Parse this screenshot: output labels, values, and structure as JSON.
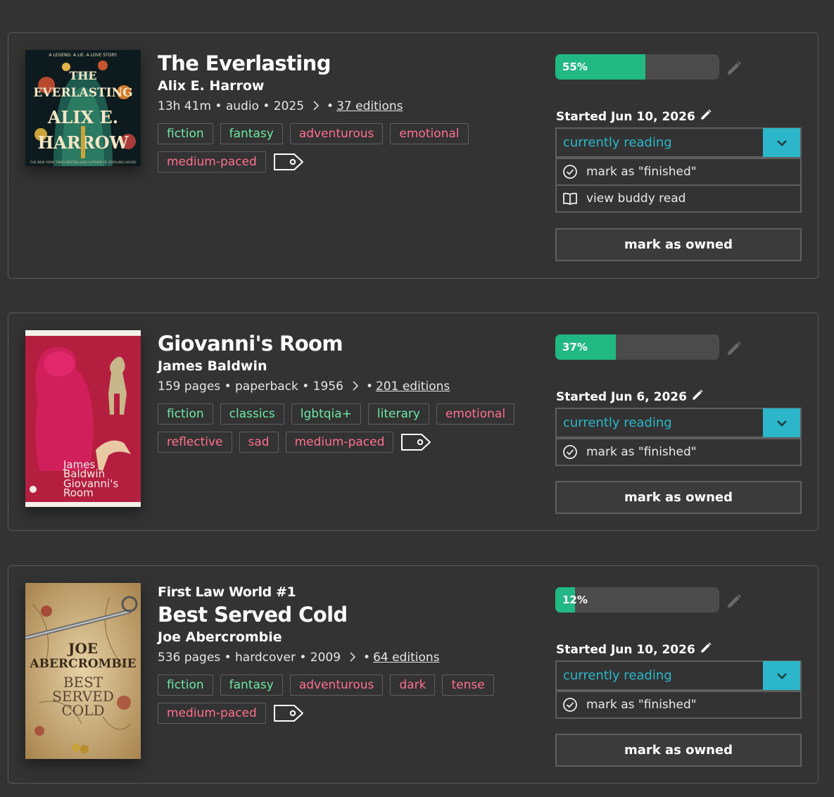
{
  "books": [
    {
      "series": "",
      "title": "The Everlasting",
      "author": "Alix E. Harrow",
      "meta": "13h 41m • audio • 2025",
      "editions": "37 editions",
      "tags": {
        "genres": [
          "fiction",
          "fantasy"
        ],
        "moods": [
          "adventurous",
          "emotional",
          "medium-paced"
        ]
      },
      "progress_percent": 55,
      "progress_label": "55%",
      "started": "Started Jun 10, 2026",
      "status": "currently reading",
      "options": [
        "mark as \"finished\"",
        "view buddy read"
      ],
      "owned_label": "mark as owned",
      "cover": {
        "line1": "A LEGEND. A LIE. A LOVE STORY.",
        "t1": "THE",
        "t2": "EVERLASTING",
        "a1": "ALIX E.",
        "a2": "HARROW",
        "bottom": "THE NEW YORK TIMES BESTSELLING AUTHOR OF STARLING HOUSE"
      }
    },
    {
      "series": "",
      "title": "Giovanni's Room",
      "author": "James Baldwin",
      "meta": "159 pages • paperback • 1956",
      "editions": "201 editions",
      "tags": {
        "genres": [
          "fiction",
          "classics",
          "lgbtqia+",
          "literary"
        ],
        "moods": [
          "emotional",
          "reflective",
          "sad",
          "medium-paced"
        ]
      },
      "progress_percent": 37,
      "progress_label": "37%",
      "started": "Started Jun 6, 2026",
      "status": "currently reading",
      "options": [
        "mark as \"finished\""
      ],
      "owned_label": "mark as owned",
      "cover": {
        "l1": "James",
        "l2": "Baldwin",
        "l3": "Giovanni's",
        "l4": "Room"
      }
    },
    {
      "series": "First Law World #1",
      "title": "Best Served Cold",
      "author": "Joe Abercrombie",
      "meta": "536 pages • hardcover • 2009",
      "editions": "64 editions",
      "tags": {
        "genres": [
          "fiction",
          "fantasy"
        ],
        "moods": [
          "adventurous",
          "dark",
          "tense",
          "medium-paced"
        ]
      },
      "progress_percent": 12,
      "progress_label": "12%",
      "started": "Started Jun 10, 2026",
      "status": "currently reading",
      "options": [
        "mark as \"finished\""
      ],
      "owned_label": "mark as owned",
      "cover": {
        "a1": "JOE",
        "a2": "ABERCROMBIE",
        "t1": "BEST",
        "t2": "SERVED",
        "t3": "COLD"
      }
    }
  ],
  "colors": {
    "genre": "#6ee7a7",
    "mood": "#ff6f91",
    "accent": "#2bb7c9",
    "progress": "#22b884"
  },
  "icons": [
    "chevron-right-icon",
    "tag-icon",
    "pencil-icon",
    "chevron-down-icon",
    "check-circle-icon",
    "book-open-icon"
  ]
}
